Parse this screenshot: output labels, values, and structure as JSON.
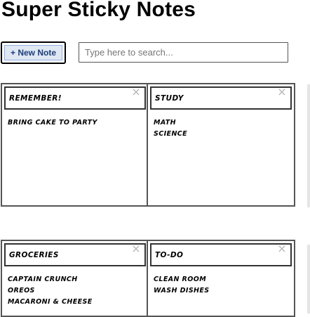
{
  "header": {
    "title": "Super Sticky Notes",
    "new_note_label": "+ New Note"
  },
  "search": {
    "placeholder": "Type here to search..."
  },
  "notes": [
    {
      "title": "Remember!",
      "close": "×",
      "lines": [
        "Bring cake to party"
      ]
    },
    {
      "title": "Study",
      "close": "×",
      "lines": [
        "Math",
        "Science"
      ]
    },
    {
      "title": "Groceries",
      "close": "×",
      "lines": [
        "Captain Crunch",
        "Oreos",
        "Macaroni & cheese"
      ]
    },
    {
      "title": "To-do",
      "close": "×",
      "lines": [
        "Clean room",
        "Wash dishes"
      ]
    }
  ]
}
